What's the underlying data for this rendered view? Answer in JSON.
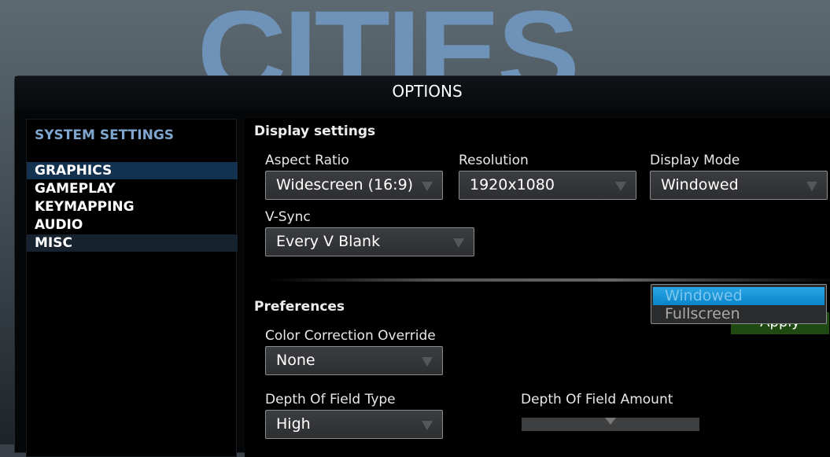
{
  "background": {
    "logo_text": "CITIES"
  },
  "window": {
    "title": "OPTIONS"
  },
  "sidebar": {
    "title": "SYSTEM SETTINGS",
    "items": [
      {
        "label": "GRAPHICS",
        "selected": true
      },
      {
        "label": "GAMEPLAY"
      },
      {
        "label": "KEYMAPPING"
      },
      {
        "label": "AUDIO"
      },
      {
        "label": "MISC",
        "hovered": true
      }
    ]
  },
  "display": {
    "heading": "Display settings",
    "aspect_ratio": {
      "label": "Aspect Ratio",
      "value": "Widescreen (16:9)"
    },
    "resolution": {
      "label": "Resolution",
      "value": "1920x1080"
    },
    "display_mode": {
      "label": "Display Mode",
      "value": "Windowed",
      "options": [
        "Windowed",
        "Fullscreen"
      ],
      "highlighted": "Windowed"
    },
    "vsync": {
      "label": "V-Sync",
      "value": "Every V Blank"
    },
    "apply_label": "Apply"
  },
  "preferences": {
    "heading": "Preferences",
    "color_correction": {
      "label": "Color Correction Override",
      "value": "None"
    },
    "dof_type": {
      "label": "Depth Of Field Type",
      "value": "High"
    },
    "dof_amount": {
      "label": "Depth Of Field Amount",
      "value_percent": 50
    }
  },
  "colors": {
    "accent": "#7ea6cf",
    "selected": "#13324f",
    "apply": "#1f4a12",
    "highlight": "#0a84c8"
  }
}
